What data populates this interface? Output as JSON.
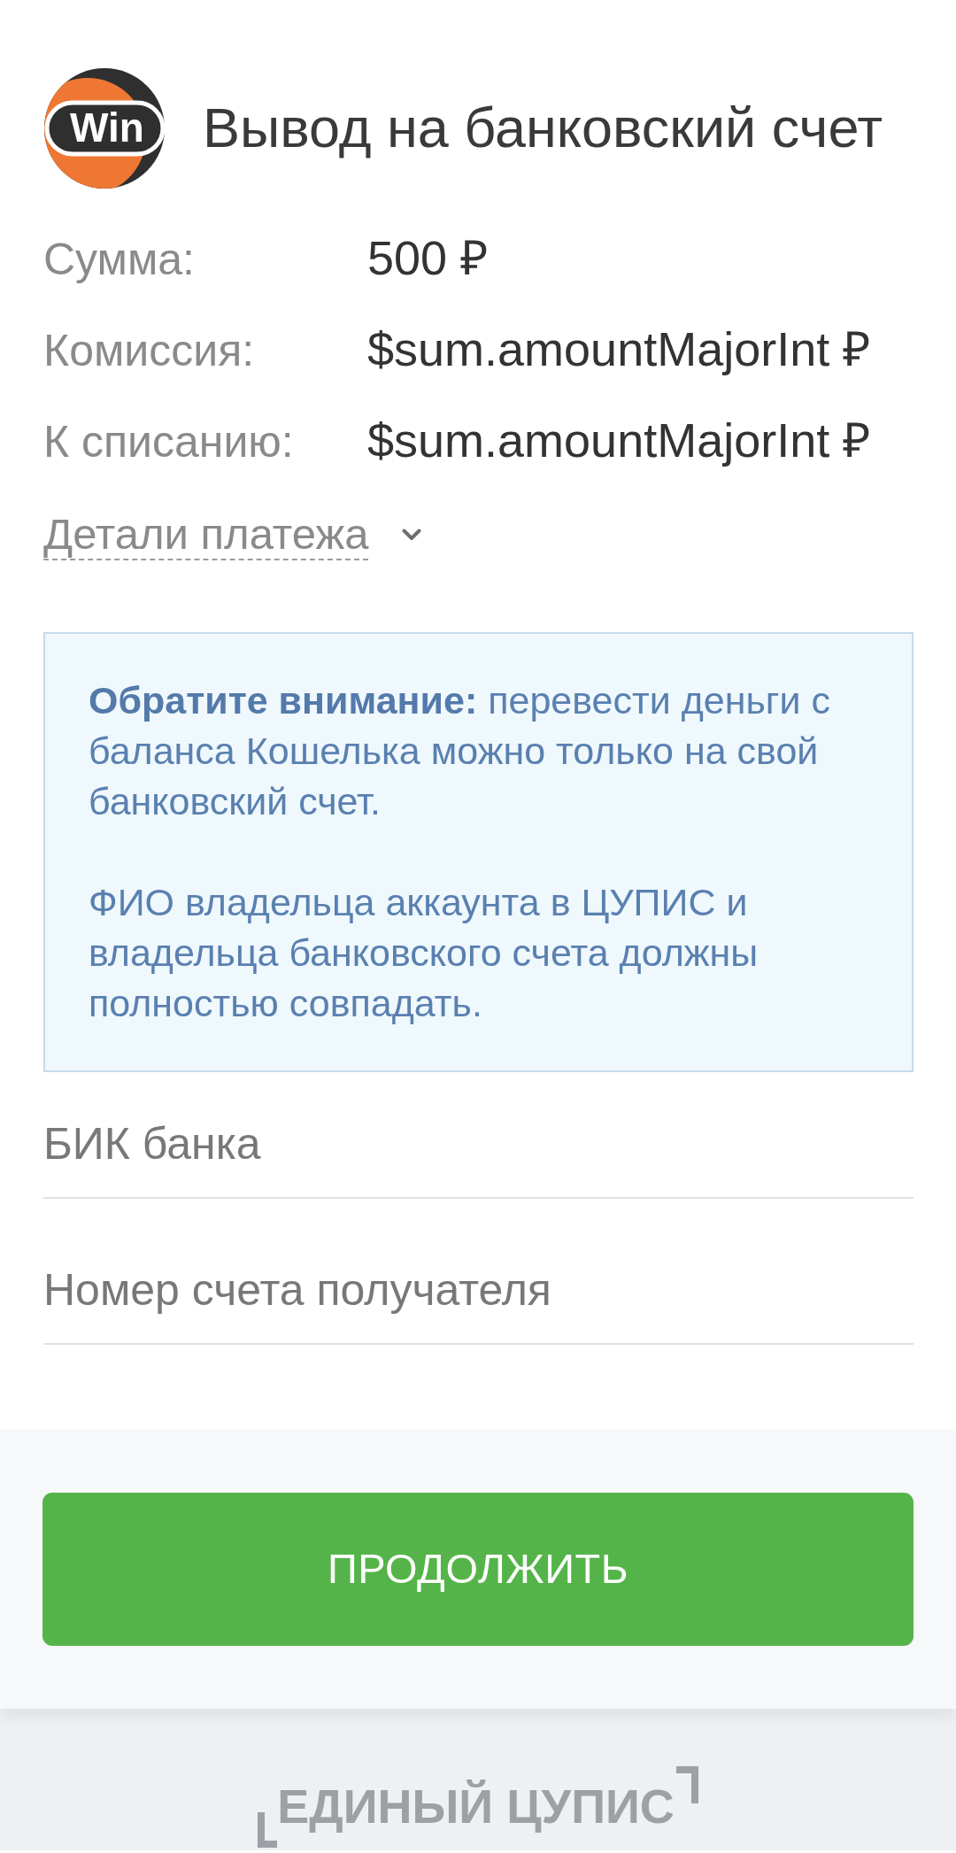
{
  "header": {
    "logo": "Win",
    "title": "Вывод на банковский счет"
  },
  "summary": [
    {
      "label": "Сумма:",
      "value": "500 ₽"
    },
    {
      "label": "Комиссия:",
      "value": "$sum.amountMajorInt ₽"
    },
    {
      "label": "К списанию:",
      "value": "$sum.amountMajorInt ₽"
    }
  ],
  "details_toggle": {
    "label": "Детали платежа",
    "expanded": false
  },
  "notice": {
    "paragraphs": [
      "**Обратите внимание:** перевести деньги с баланса Кошелька можно только на свой банковский счет.",
      "ФИО владельца аккаунта в ЦУПИС и владельца банковского счета должны полностью совпадать."
    ]
  },
  "fields": [
    {
      "placeholder": "БИК банка"
    },
    {
      "placeholder": "Номер счета получателя"
    }
  ],
  "submit_button": {
    "label": "ПРОДОЛЖИТЬ"
  },
  "footer": {
    "logo": "ЕДИНЫЙ ЦУПИС"
  }
}
